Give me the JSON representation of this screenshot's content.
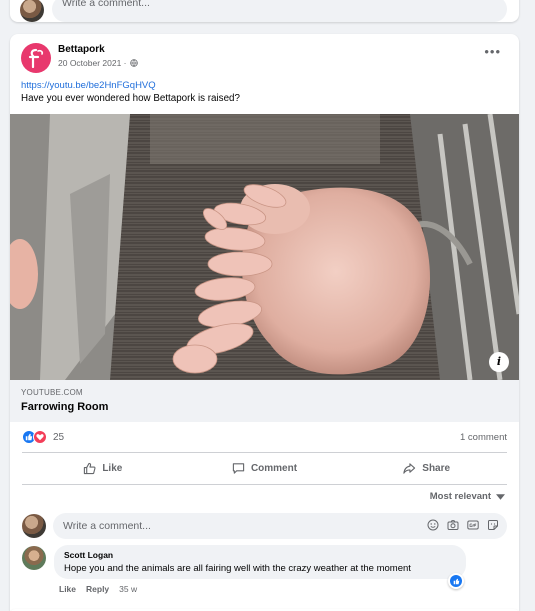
{
  "previous_post": {
    "comment_placeholder": "Write a comment..."
  },
  "post": {
    "page_name": "Bettapork",
    "date": "20 October 2021 ·",
    "privacy_icon": "globe-icon",
    "more_label": "•••",
    "link_url": "https://youtu.be/be2HnFGqHVQ",
    "text": "Have you ever wondered how Bettapork is raised?",
    "photo_info_label": "i",
    "link_preview": {
      "domain": "YOUTUBE.COM",
      "title": "Farrowing Room"
    },
    "reactions": {
      "count": "25",
      "types": [
        "like-icon",
        "love-icon"
      ]
    },
    "comment_count": "1 comment",
    "actions": {
      "like": "Like",
      "comment": "Comment",
      "share": "Share"
    },
    "sort_label": "Most relevant",
    "comment_placeholder": "Write a comment...",
    "comments": [
      {
        "author": "Scott Logan",
        "text": "Hope you and the animals are all fairing well with the crazy weather at the moment",
        "like_label": "Like",
        "reply_label": "Reply",
        "time": "35 w"
      }
    ]
  },
  "colors": {
    "brand": "#e8386d",
    "link": "#216fdb",
    "like_blue": "#1877f2",
    "love_red": "#f33e58",
    "background": "#f0f2f5"
  }
}
